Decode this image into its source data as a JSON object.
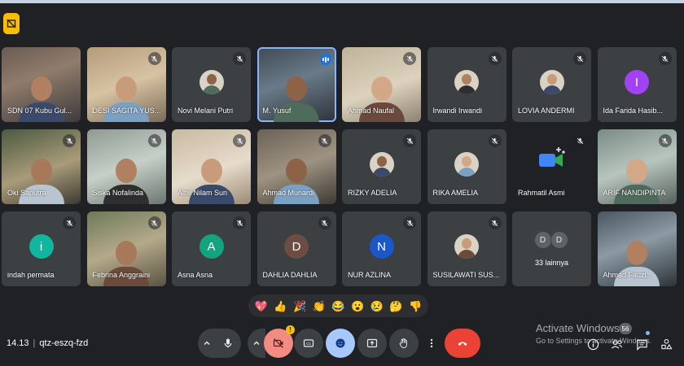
{
  "meeting": {
    "time": "14.13",
    "code": "qtz-eszq-fzd"
  },
  "participants": [
    {
      "name": "SDN 07 Kubu Gul...",
      "type": "video",
      "muted": false
    },
    {
      "name": "DESI SAGITA YUS...",
      "type": "video",
      "muted": true
    },
    {
      "name": "Novi Melani Putri",
      "type": "photo-avatar",
      "muted": true
    },
    {
      "name": "M. Yusuf",
      "type": "video",
      "muted": false,
      "speaking": true
    },
    {
      "name": "Ahmad Naufal",
      "type": "video",
      "muted": true
    },
    {
      "name": "Irwandi Irwandi",
      "type": "photo-avatar",
      "muted": true
    },
    {
      "name": "LOVIA ANDERMI",
      "type": "photo-avatar",
      "muted": true
    },
    {
      "name": "Ida Farida Hasib...",
      "type": "letter-avatar",
      "initial": "I",
      "color": "#a142f4",
      "muted": true
    },
    {
      "name": "Oki Saputra",
      "type": "video",
      "muted": true
    },
    {
      "name": "Siska Nofalinda",
      "type": "video",
      "muted": true
    },
    {
      "name": "Alhil Nilam Suri",
      "type": "video",
      "muted": true
    },
    {
      "name": "Ahmad Munardi",
      "type": "video",
      "muted": true
    },
    {
      "name": "RIZKY ADELIA",
      "type": "photo-avatar",
      "muted": true
    },
    {
      "name": "RIKA AMELIA",
      "type": "photo-avatar",
      "muted": true
    },
    {
      "name": "Rahmatil Asmi",
      "type": "meet-logo",
      "muted": true
    },
    {
      "name": "ARIF NANDIPINTA",
      "type": "video",
      "muted": true
    },
    {
      "name": "indah permata",
      "type": "letter-avatar",
      "initial": "i",
      "color": "#12b5a0",
      "muted": true
    },
    {
      "name": "Febrina Anggraini",
      "type": "video",
      "muted": true
    },
    {
      "name": "Asna Asna",
      "type": "letter-avatar",
      "initial": "A",
      "color": "#12a37f",
      "muted": true
    },
    {
      "name": "DAHLIA DAHLIA",
      "type": "letter-avatar",
      "initial": "D",
      "color": "#6d4c41",
      "muted": true
    },
    {
      "name": "NUR AZLINA",
      "type": "letter-avatar",
      "initial": "N",
      "color": "#1a57c8",
      "muted": true
    },
    {
      "name": "SUSILAWATI SUS...",
      "type": "photo-avatar",
      "muted": true
    },
    {
      "name": "33 lainnya",
      "type": "more",
      "initials": [
        "D",
        "D"
      ]
    },
    {
      "name": "Ahmad Fauzi...",
      "type": "video",
      "muted": false
    }
  ],
  "reactions": [
    "💖",
    "👍",
    "🎉",
    "👏",
    "😂",
    "😮",
    "😢",
    "🤔",
    "👎"
  ],
  "watermark": {
    "line1": "Activate Windows",
    "line2": "Go to Settings to activate Windows."
  },
  "badges": {
    "people_count": "56",
    "camera_warning": "!"
  },
  "colors": {
    "end_call": "#ea4335",
    "camera_off": "#f28b82",
    "active": "#a8c7fa",
    "speaking": "#1a73e8"
  }
}
